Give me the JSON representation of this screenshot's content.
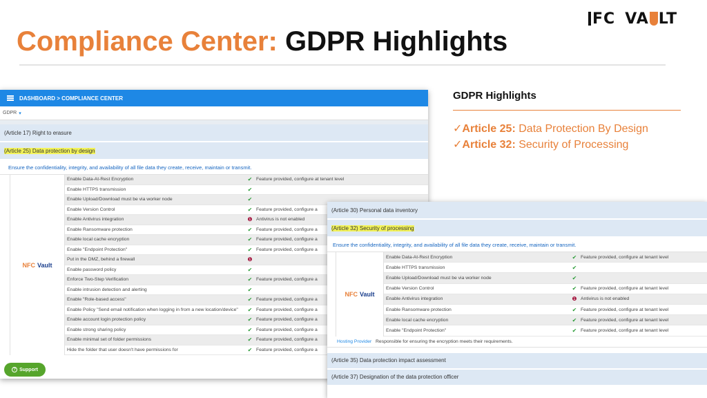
{
  "slide": {
    "title_accent": "Compliance Center:",
    "title_main": "GDPR Highlights",
    "logo_left": "FC",
    "logo_right_a": "VA",
    "logo_right_b": "LT"
  },
  "panel": {
    "heading": "GDPR Highlights",
    "points": [
      {
        "article": "Article 25:",
        "text": "Data Protection By Design"
      },
      {
        "article": "Article 32:",
        "text": "Security of Processing"
      }
    ],
    "check_glyph": "✓"
  },
  "screenshot1": {
    "appbar": "DASHBOARD > COMPLIANCE CENTER",
    "dropdown_value": "GDPR",
    "articles": [
      "(Article 17) Right to erasure",
      "(Article 25) Data protection by design"
    ],
    "ensure_text": "Ensure the confidentiality, integrity, and availability of all file data they create, receive, maintain or transmit.",
    "brand_nfc": "NFC",
    "brand_vault": "Vault",
    "rows": [
      {
        "feature": "Enable Data-At-Rest Encryption",
        "status": "ok",
        "note": "Feature provided, configure at tenant level"
      },
      {
        "feature": "Enable HTTPS transmission",
        "status": "ok",
        "note": ""
      },
      {
        "feature": "Enable Upload/Download must be via worker node",
        "status": "ok",
        "note": ""
      },
      {
        "feature": "Enable Version Control",
        "status": "ok",
        "note": "Feature provided, configure a"
      },
      {
        "feature": "Enable Antivirus integration",
        "status": "bad",
        "note": "Antivirus is not enabled"
      },
      {
        "feature": "Enable Ransomware protection",
        "status": "ok",
        "note": "Feature provided, configure a"
      },
      {
        "feature": "Enable local cache encryption",
        "status": "ok",
        "note": "Feature provided, configure a"
      },
      {
        "feature": "Enable \"Endpoint Protection\"",
        "status": "ok",
        "note": "Feature provided, configure a"
      },
      {
        "feature": "Put        in the DMZ, behind a firewall",
        "status": "bad",
        "note": ""
      },
      {
        "feature": "Enable password policy",
        "status": "ok",
        "note": ""
      },
      {
        "feature": "Enforce Two-Step Verification",
        "status": "ok",
        "note": "Feature provided, configure a"
      },
      {
        "feature": "Enable intrusion detection and alerting",
        "status": "ok",
        "note": ""
      },
      {
        "feature": "Enable \"Role-based access\"",
        "status": "ok",
        "note": "Feature provided, configure a"
      },
      {
        "feature": "Enable Policy \"Send email notification when logging in from a new location/device\"",
        "status": "ok",
        "note": "Feature provided, configure a"
      },
      {
        "feature": "Enable account login protection policy",
        "status": "ok",
        "note": "Feature provided, configure a"
      },
      {
        "feature": "Enable strong sharing policy",
        "status": "ok",
        "note": "Feature provided, configure a"
      },
      {
        "feature": "Enable minimal set of folder permissions",
        "status": "ok",
        "note": "Feature provided, configure a"
      },
      {
        "feature": "Hide the folder that user doesn't have permissions for",
        "status": "ok",
        "note": "Feature provided, configure a"
      }
    ],
    "support_label": "Support",
    "support_icon": "?"
  },
  "screenshot2": {
    "articles_top": [
      "(Article 30) Personal data inventory",
      "(Article 32) Security of processing"
    ],
    "ensure_text": "Ensure the confidentiality, integrity, and availability of all file data they create, receive, maintain or transmit.",
    "brand_nfc": "NFC",
    "brand_vault": "Vault",
    "rows": [
      {
        "feature": "Enable Data-At-Rest Encryption",
        "status": "ok",
        "note": "Feature provided, configure at tenant level"
      },
      {
        "feature": "Enable HTTPS transmission",
        "status": "ok",
        "note": ""
      },
      {
        "feature": "Enable Upload/Download must be via worker node",
        "status": "ok",
        "note": ""
      },
      {
        "feature": "Enable Version Control",
        "status": "ok",
        "note": "Feature provided, configure at tenant level"
      },
      {
        "feature": "Enable Antivirus integration",
        "status": "bad",
        "note": "Antivirus is not enabled"
      },
      {
        "feature": "Enable Ransomware protection",
        "status": "ok",
        "note": "Feature provided, configure at tenant level"
      },
      {
        "feature": "Enable local cache encryption",
        "status": "ok",
        "note": "Feature provided, configure at tenant level"
      },
      {
        "feature": "Enable \"Endpoint Protection\"",
        "status": "ok",
        "note": "Feature provided, configure at tenant level"
      }
    ],
    "provider_name": "Hosting Provider",
    "provider_text": "Responsible for ensuring the encryption meets their requirements.",
    "articles_bottom": [
      "(Article 35) Data protection impact assessment",
      "(Article 37) Designation of the data protection officer"
    ]
  },
  "glyphs": {
    "ok": "✔",
    "bad": "❶"
  },
  "colors": {
    "accent": "#e8813a",
    "appbar": "#1e88e5",
    "ok": "#2e9d3a",
    "bad": "#a4133c",
    "highlight": "#f3f359"
  }
}
